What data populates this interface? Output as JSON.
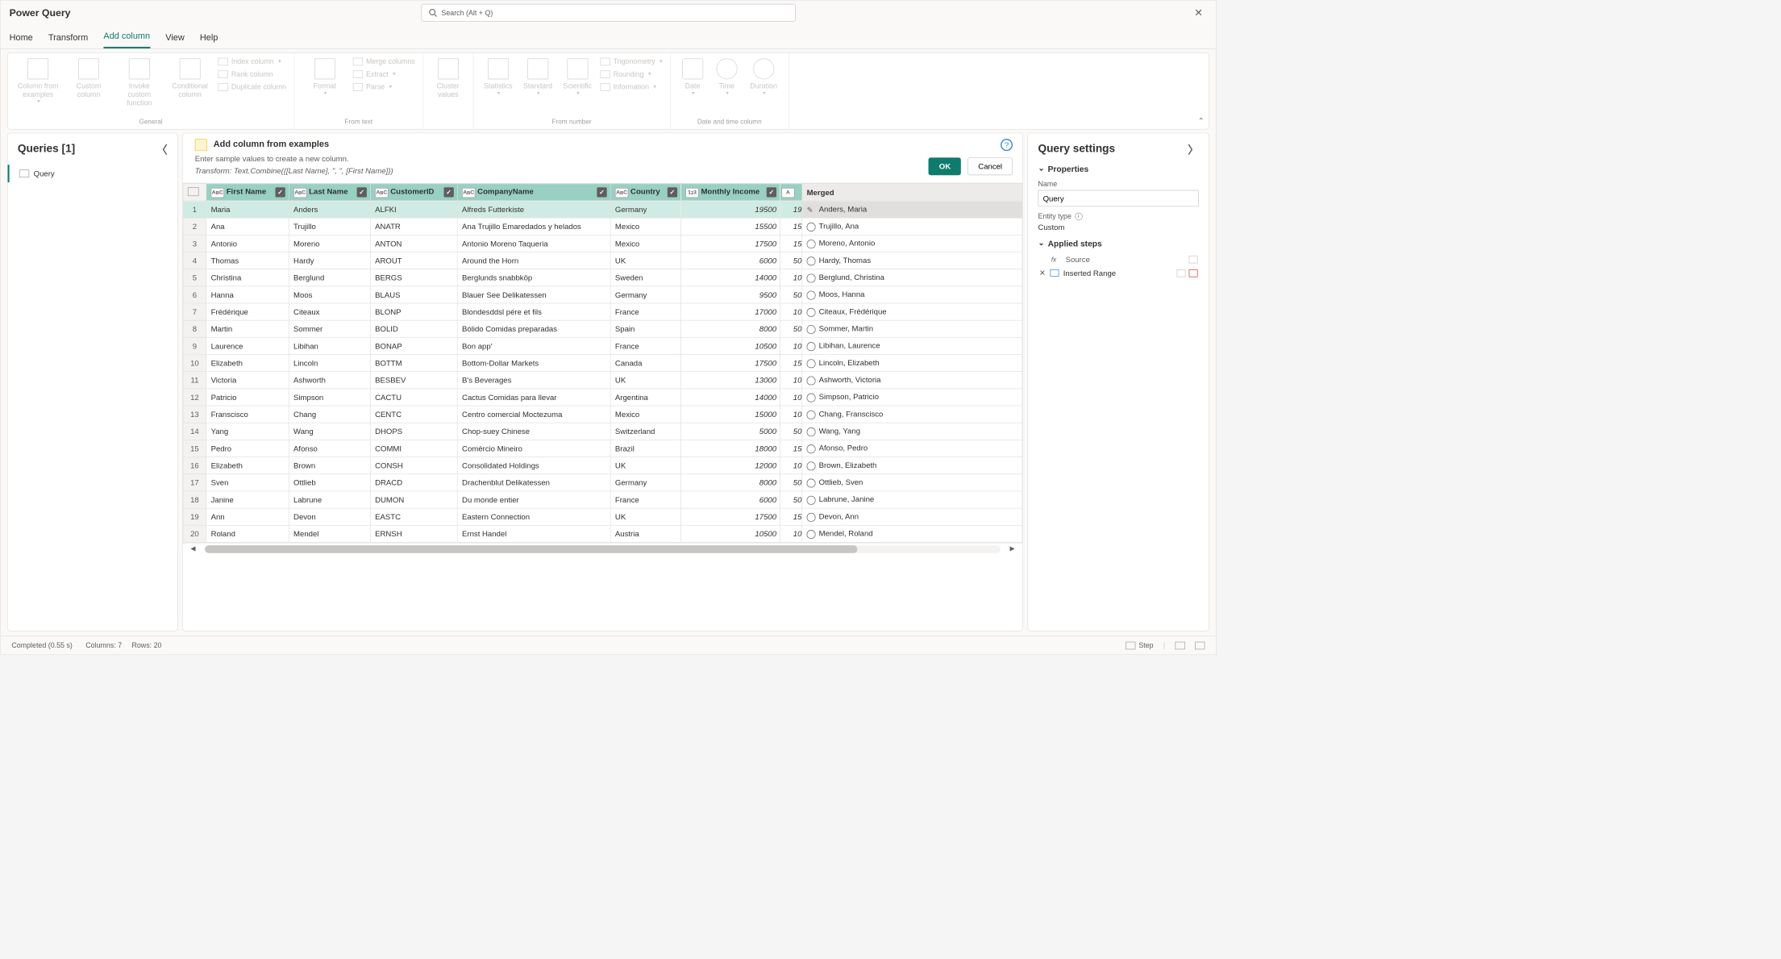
{
  "title": "Power Query",
  "search_placeholder": "Search (Alt + Q)",
  "tabs": {
    "home": "Home",
    "transform": "Transform",
    "add": "Add column",
    "view": "View",
    "help": "Help"
  },
  "ribbon": {
    "general_label": "General",
    "from_text_label": "From text",
    "from_number_label": "From number",
    "date_label": "Date and time column",
    "col_ex": "Column from examples",
    "cust": "Custom column",
    "invoke": "Invoke custom function",
    "cond": "Conditional column",
    "index": "Index column",
    "rank": "Rank column",
    "dup": "Duplicate column",
    "format": "Format",
    "merge": "Merge columns",
    "extract": "Extract",
    "parse": "Parse",
    "cluster": "Cluster values",
    "stats": "Statistics",
    "standard": "Standard",
    "sci": "Scientific",
    "trig": "Trigonometry",
    "round": "Rounding",
    "info": "Information",
    "date": "Date",
    "time": "Time",
    "dur": "Duration"
  },
  "queries": {
    "title": "Queries [1]",
    "item": "Query"
  },
  "prompt": {
    "title": "Add column from examples",
    "desc": "Enter sample values to create a new column.",
    "trans": "Transform: Text.Combine({[Last Name], \", \", [First Name]})",
    "ok": "OK",
    "cancel": "Cancel"
  },
  "cols": {
    "first": "First Name",
    "last": "Last Name",
    "cust": "CustomerID",
    "comp": "CompanyName",
    "country": "Country",
    "inc": "Monthly Income",
    "merged": "Merged"
  },
  "rows": [
    {
      "n": "1",
      "first": "Maria",
      "last": "Anders",
      "cust": "ALFKI",
      "comp": "Alfreds Futterkiste",
      "country": "Germany",
      "inc": "19500",
      "clip": "19",
      "merged": "Anders, Maria"
    },
    {
      "n": "2",
      "first": "Ana",
      "last": "Trujillo",
      "cust": "ANATR",
      "comp": "Ana Trujillo Emaredados y helados",
      "country": "Mexico",
      "inc": "15500",
      "clip": "15",
      "merged": "Trujillo, Ana"
    },
    {
      "n": "3",
      "first": "Antonio",
      "last": "Moreno",
      "cust": "ANTON",
      "comp": "Antonio Moreno Taqueria",
      "country": "Mexico",
      "inc": "17500",
      "clip": "15",
      "merged": "Moreno, Antonio"
    },
    {
      "n": "4",
      "first": "Thomas",
      "last": "Hardy",
      "cust": "AROUT",
      "comp": "Around the Horn",
      "country": "UK",
      "inc": "6000",
      "clip": "50",
      "merged": "Hardy, Thomas"
    },
    {
      "n": "5",
      "first": "Christina",
      "last": "Berglund",
      "cust": "BERGS",
      "comp": "Berglunds snabbköp",
      "country": "Sweden",
      "inc": "14000",
      "clip": "10",
      "merged": "Berglund, Christina"
    },
    {
      "n": "6",
      "first": "Hanna",
      "last": "Moos",
      "cust": "BLAUS",
      "comp": "Blauer See Delikatessen",
      "country": "Germany",
      "inc": "9500",
      "clip": "50",
      "merged": "Moos, Hanna"
    },
    {
      "n": "7",
      "first": "Frédérique",
      "last": "Citeaux",
      "cust": "BLONP",
      "comp": "Blondesddsl pére et fils",
      "country": "France",
      "inc": "17000",
      "clip": "10",
      "merged": "Citeaux, Frédérique"
    },
    {
      "n": "8",
      "first": "Martin",
      "last": "Sommer",
      "cust": "BOLID",
      "comp": "Bólido Comidas preparadas",
      "country": "Spain",
      "inc": "8000",
      "clip": "50",
      "merged": "Sommer, Martin"
    },
    {
      "n": "9",
      "first": "Laurence",
      "last": "Libihan",
      "cust": "BONAP",
      "comp": "Bon app'",
      "country": "France",
      "inc": "10500",
      "clip": "10",
      "merged": "Libihan, Laurence"
    },
    {
      "n": "10",
      "first": "Elizabeth",
      "last": "Lincoln",
      "cust": "BOTTM",
      "comp": "Bottom-Dollar Markets",
      "country": "Canada",
      "inc": "17500",
      "clip": "15",
      "merged": "Lincoln, Elizabeth"
    },
    {
      "n": "11",
      "first": "Victoria",
      "last": "Ashworth",
      "cust": "BESBEV",
      "comp": "B's Beverages",
      "country": "UK",
      "inc": "13000",
      "clip": "10",
      "merged": "Ashworth, Victoria"
    },
    {
      "n": "12",
      "first": "Patricio",
      "last": "Simpson",
      "cust": "CACTU",
      "comp": "Cactus Comidas para llevar",
      "country": "Argentina",
      "inc": "14000",
      "clip": "10",
      "merged": "Simpson, Patricio"
    },
    {
      "n": "13",
      "first": "Franscisco",
      "last": "Chang",
      "cust": "CENTC",
      "comp": "Centro comercial Moctezuma",
      "country": "Mexico",
      "inc": "15000",
      "clip": "10",
      "merged": "Chang, Franscisco"
    },
    {
      "n": "14",
      "first": "Yang",
      "last": "Wang",
      "cust": "DHOPS",
      "comp": "Chop-suey Chinese",
      "country": "Switzerland",
      "inc": "5000",
      "clip": "50",
      "merged": "Wang, Yang"
    },
    {
      "n": "15",
      "first": "Pedro",
      "last": "Afonso",
      "cust": "COMMI",
      "comp": "Comércio Mineiro",
      "country": "Brazil",
      "inc": "18000",
      "clip": "15",
      "merged": "Afonso, Pedro"
    },
    {
      "n": "16",
      "first": "Elizabeth",
      "last": "Brown",
      "cust": "CONSH",
      "comp": "Consolidated Holdings",
      "country": "UK",
      "inc": "12000",
      "clip": "10",
      "merged": "Brown, Elizabeth"
    },
    {
      "n": "17",
      "first": "Sven",
      "last": "Ottlieb",
      "cust": "DRACD",
      "comp": "Drachenblut Delikatessen",
      "country": "Germany",
      "inc": "8000",
      "clip": "50",
      "merged": "Ottlieb, Sven"
    },
    {
      "n": "18",
      "first": "Janine",
      "last": "Labrune",
      "cust": "DUMON",
      "comp": "Du monde entier",
      "country": "France",
      "inc": "6000",
      "clip": "50",
      "merged": "Labrune, Janine"
    },
    {
      "n": "19",
      "first": "Ann",
      "last": "Devon",
      "cust": "EASTC",
      "comp": "Eastern Connection",
      "country": "UK",
      "inc": "17500",
      "clip": "15",
      "merged": "Devon, Ann"
    },
    {
      "n": "20",
      "first": "Roland",
      "last": "Mendel",
      "cust": "ERNSH",
      "comp": "Ernst Handel",
      "country": "Austria",
      "inc": "10500",
      "clip": "10",
      "merged": "Mendel, Roland"
    }
  ],
  "settings": {
    "title": "Query settings",
    "props": "Properties",
    "name_label": "Name",
    "name_value": "Query",
    "entity_label": "Entity type",
    "entity_value": "Custom",
    "steps_label": "Applied steps",
    "step1": "Source",
    "step2": "Inserted Range"
  },
  "status": {
    "done": "Completed (0.55 s)",
    "cols": "Columns: 7",
    "rows": "Rows: 20",
    "step": "Step"
  }
}
